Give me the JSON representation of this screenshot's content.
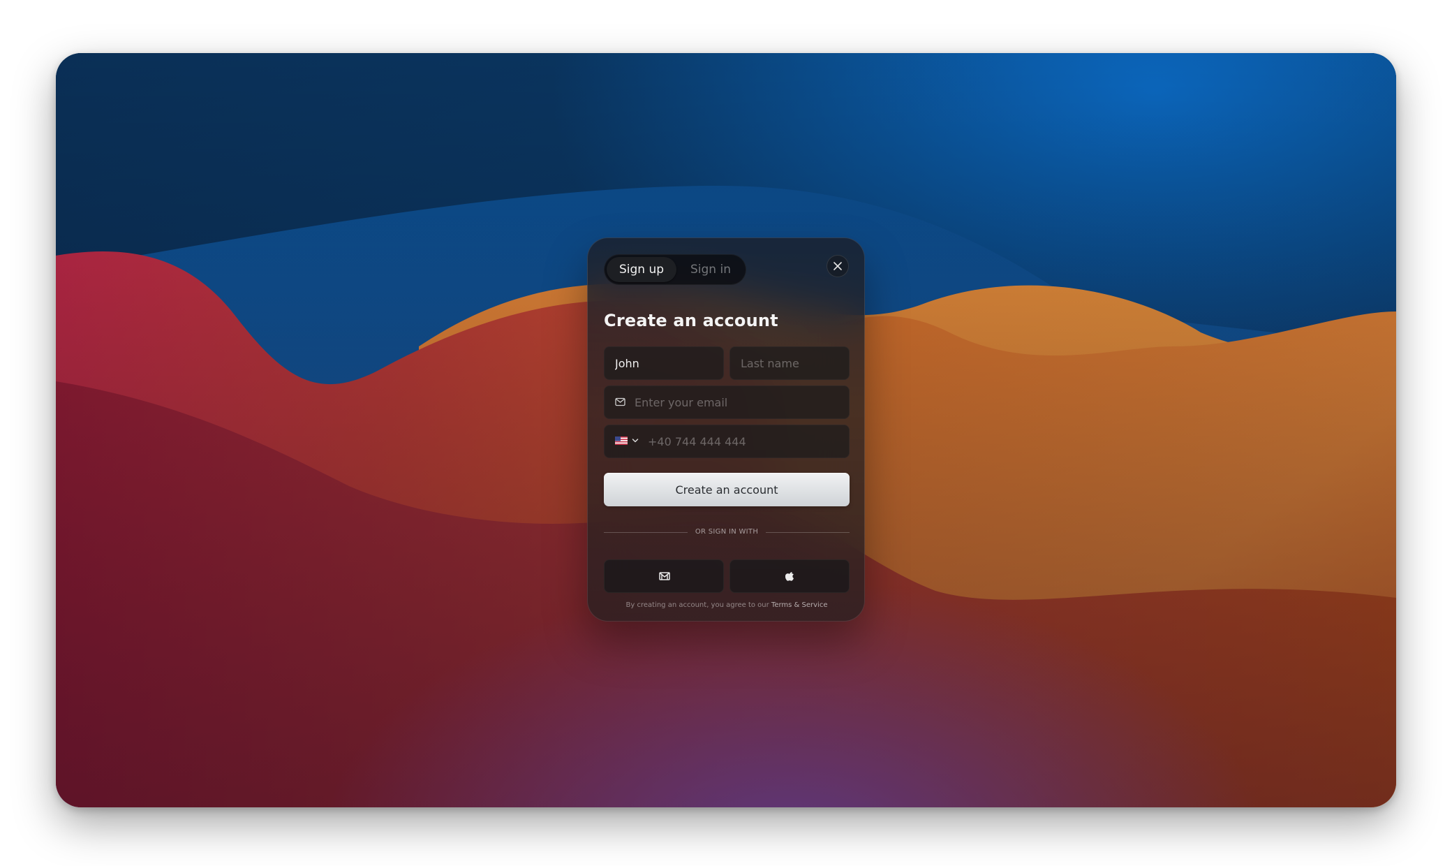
{
  "auth_modal": {
    "tabs": [
      {
        "label": "Sign up",
        "active": true
      },
      {
        "label": "Sign in",
        "active": false
      }
    ],
    "title": "Create an account",
    "first_name": {
      "value": "John",
      "placeholder": ""
    },
    "last_name": {
      "value": "",
      "placeholder": "Last name"
    },
    "email": {
      "value": "",
      "placeholder": "Enter your email",
      "icon": "mail-icon"
    },
    "phone": {
      "value": "",
      "placeholder": "+40 744 444 444",
      "country_flag": "us-flag-icon"
    },
    "submit_label": "Create an account",
    "divider_label": "OR SIGN IN WITH",
    "social": [
      {
        "provider": "google",
        "icon": "gmail-icon"
      },
      {
        "provider": "apple",
        "icon": "apple-icon"
      }
    ],
    "terms_text": "By creating an account, you agree to our ",
    "terms_link": "Terms & Service"
  },
  "colors": {
    "wallpaper_blue": "#0b5fae",
    "wallpaper_red": "#c8344a",
    "wallpaper_orange": "#e9852f",
    "button_light": "#e8eaec"
  }
}
